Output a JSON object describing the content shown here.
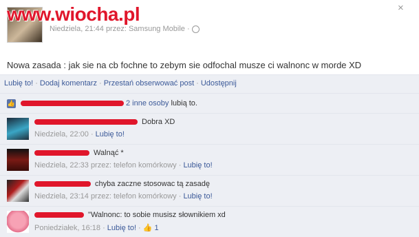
{
  "watermark": "www.wiocha.pl",
  "post": {
    "meta": "Niedziela, 21:44 przez: Samsung Mobile · ",
    "text": "Nowa zasada : jak sie na cb fochne to zebym sie odfochal musze ci walnonc w morde XD",
    "close": "×"
  },
  "actions": {
    "like": "Lubię to!",
    "comment": "Dodaj komentarz",
    "unfollow": "Przestań obserwować post",
    "share": "Udostępnij",
    "sep": "·"
  },
  "likes": {
    "others_link": "2 inne osoby",
    "suffix": " lubią to."
  },
  "comments": [
    {
      "text": " Dobra XD",
      "meta": "Niedziela, 22:00 · ",
      "like": "Lubię to!"
    },
    {
      "text": " Walnąć *",
      "meta": "Niedziela, 22:33 przez: telefon komórkowy · ",
      "like": "Lubię to!"
    },
    {
      "text": " chyba zaczne stosowac tą zasadę",
      "meta": "Niedziela, 23:14 przez: telefon komórkowy · ",
      "like": "Lubię to!"
    },
    {
      "text": " \"Walnonc: to sobie musisz słownikiem xd",
      "meta": "Poniedziałek, 16:18 · ",
      "like": "Lubię to!",
      "like_count": "1"
    }
  ]
}
